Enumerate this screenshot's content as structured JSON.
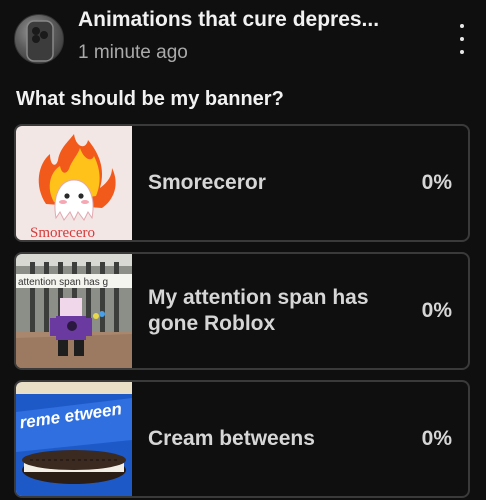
{
  "post": {
    "channel_name": "Animations that cure depres...",
    "timestamp": "1 minute ago",
    "question": "What should be my banner?"
  },
  "poll": {
    "options": [
      {
        "label": "Smoreceror",
        "percent": "0%",
        "thumb_text": "Smorecero"
      },
      {
        "label": "My attention span has gone Roblox",
        "percent": "0%",
        "thumb_text": "attention span has g"
      },
      {
        "label": "Cream betweens",
        "percent": "0%",
        "thumb_text": "reme etween"
      }
    ]
  },
  "icons": {
    "menu": "more-vertical-icon",
    "avatar": "channel-avatar"
  }
}
